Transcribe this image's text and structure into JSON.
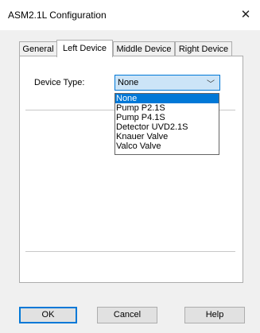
{
  "window": {
    "title": "ASM2.1L Configuration",
    "close_glyph": "✕"
  },
  "tabs": [
    {
      "label": "General",
      "selected": false
    },
    {
      "label": "Left Device",
      "selected": true
    },
    {
      "label": "Middle Device",
      "selected": false
    },
    {
      "label": "Right Device",
      "selected": false
    }
  ],
  "device_type": {
    "label": "Device Type:",
    "selected_value": "None",
    "arrow_glyph": "﹀",
    "options": [
      "None",
      "Pump P2.1S",
      "Pump P4.1S",
      "Detector UVD2.1S",
      "Knauer Valve",
      "Valco Valve"
    ],
    "highlighted_index": 0
  },
  "buttons": {
    "ok": "OK",
    "cancel": "Cancel",
    "help": "Help"
  },
  "colors": {
    "accent": "#0078d7",
    "combo_fill": "#cce4f7",
    "dialog_background": "#f0f0f0"
  }
}
